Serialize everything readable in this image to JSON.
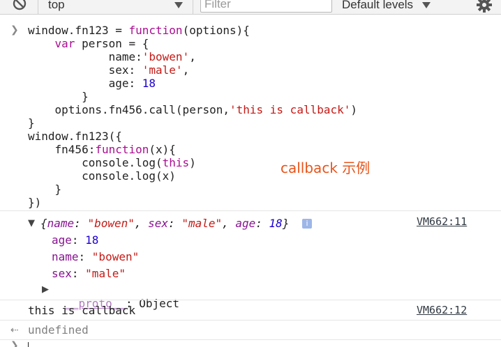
{
  "toolbar": {
    "context": "top",
    "filter_placeholder": "Filter",
    "levels": "Default levels",
    "icons": [
      "clear-console-icon",
      "context-dropdown-icon",
      "levels-dropdown-icon",
      "settings-gear-icon"
    ]
  },
  "input": {
    "lines": [
      [
        {
          "t": "window.fn123 = "
        },
        {
          "t": "function",
          "c": "kw"
        },
        {
          "t": "(options){"
        }
      ],
      [
        {
          "t": "    "
        },
        {
          "t": "var",
          "c": "kw"
        },
        {
          "t": " person = {"
        }
      ],
      [
        {
          "t": "            name:"
        },
        {
          "t": "'bowen'",
          "c": "str"
        },
        {
          "t": ","
        }
      ],
      [
        {
          "t": "            sex: "
        },
        {
          "t": "'male'",
          "c": "str"
        },
        {
          "t": ","
        }
      ],
      [
        {
          "t": "            age: "
        },
        {
          "t": "18",
          "c": "num"
        }
      ],
      [
        {
          "t": "        }"
        }
      ],
      [
        {
          "t": "    options.fn456.call(person,"
        },
        {
          "t": "'this is callback'",
          "c": "str"
        },
        {
          "t": ")"
        }
      ],
      [
        {
          "t": "}"
        }
      ],
      [
        {
          "t": "window.fn123({"
        }
      ],
      [
        {
          "t": "    fn456:"
        },
        {
          "t": "function",
          "c": "kw"
        },
        {
          "t": "(x){"
        }
      ],
      [
        {
          "t": "        console.log("
        },
        {
          "t": "this",
          "c": "kw"
        },
        {
          "t": ")"
        }
      ],
      [
        {
          "t": "        console.log(x)"
        }
      ],
      [
        {
          "t": "    }"
        }
      ],
      [
        {
          "t": "})"
        }
      ]
    ]
  },
  "annotation": "callback 示例",
  "output": {
    "object_preview": [
      {
        "t": "{"
      },
      {
        "t": "name",
        "c": "pn"
      },
      {
        "t": ": "
      },
      {
        "t": "\"bowen\"",
        "c": "str"
      },
      {
        "t": ", "
      },
      {
        "t": "sex",
        "c": "pn"
      },
      {
        "t": ": "
      },
      {
        "t": "\"male\"",
        "c": "str"
      },
      {
        "t": ", "
      },
      {
        "t": "age",
        "c": "pn"
      },
      {
        "t": ": "
      },
      {
        "t": "18",
        "c": "num"
      },
      {
        "t": "}"
      }
    ],
    "info_badge": "i",
    "source_1": "VM662:11",
    "properties": [
      [
        {
          "t": "age",
          "c": "pn"
        },
        {
          "t": ": "
        },
        {
          "t": "18",
          "c": "num"
        }
      ],
      [
        {
          "t": "name",
          "c": "pn"
        },
        {
          "t": ": "
        },
        {
          "t": "\"bowen\"",
          "c": "str"
        }
      ],
      [
        {
          "t": "sex",
          "c": "pn"
        },
        {
          "t": ": "
        },
        {
          "t": "\"male\"",
          "c": "str"
        }
      ]
    ],
    "proto_key": "__proto__",
    "proto_value": ": Object",
    "log_text": "this is callback",
    "source_2": "VM662:12",
    "return_value": "undefined"
  },
  "colors": {
    "keyword": "#aa0d91",
    "string": "#c41a16",
    "number": "#1c00cf",
    "property": "#881391",
    "annotation": "#e8541a"
  }
}
